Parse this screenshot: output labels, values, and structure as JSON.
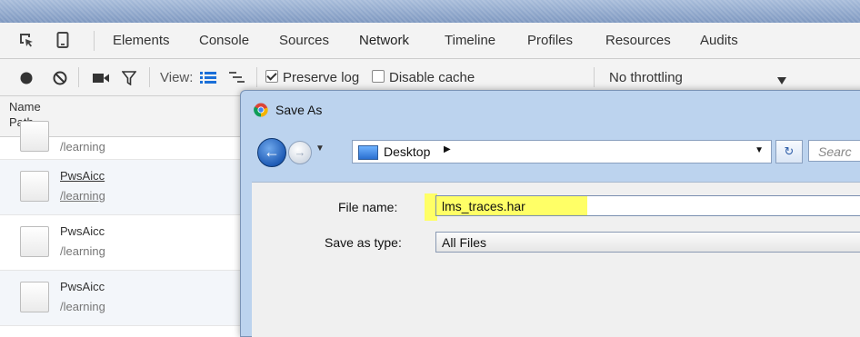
{
  "devtools": {
    "tabs": [
      {
        "label": "Elements"
      },
      {
        "label": "Console"
      },
      {
        "label": "Sources"
      },
      {
        "label": "Network"
      },
      {
        "label": "Timeline"
      },
      {
        "label": "Profiles"
      },
      {
        "label": "Resources"
      },
      {
        "label": "Audits"
      }
    ],
    "selected_tab": "Network",
    "icons": {
      "inspect": "inspect-icon",
      "device": "device-mode-icon"
    }
  },
  "network_toolbar": {
    "view_label": "View:",
    "preserve_log": {
      "label": "Preserve log",
      "checked": true
    },
    "disable_cache": {
      "label": "Disable cache",
      "checked": false
    },
    "throttling": "No throttling",
    "icons": [
      "record-icon",
      "clear-icon",
      "camera-icon",
      "filter-icon",
      "list-view-icon",
      "waterfall-view-icon",
      "dropdown-arrow-icon"
    ]
  },
  "request_list": {
    "header": {
      "name": "Name",
      "path": "Path"
    },
    "rows": [
      {
        "name": "",
        "path": "/learning"
      },
      {
        "name": "PwsAicc",
        "path": "/learning"
      },
      {
        "name": "PwsAicc",
        "path": "/learning"
      },
      {
        "name": "PwsAicc",
        "path": "/learning"
      }
    ]
  },
  "save_dialog": {
    "title": "Save As",
    "location": "Desktop",
    "search_placeholder": "Searc",
    "file_name_label": "File name:",
    "file_name_value": "lms_traces.har",
    "save_type_label": "Save as type:",
    "save_type_value": "All Files"
  },
  "colors": {
    "highlight": "#ffff66",
    "dialog_frame": "#bcd3ee"
  }
}
